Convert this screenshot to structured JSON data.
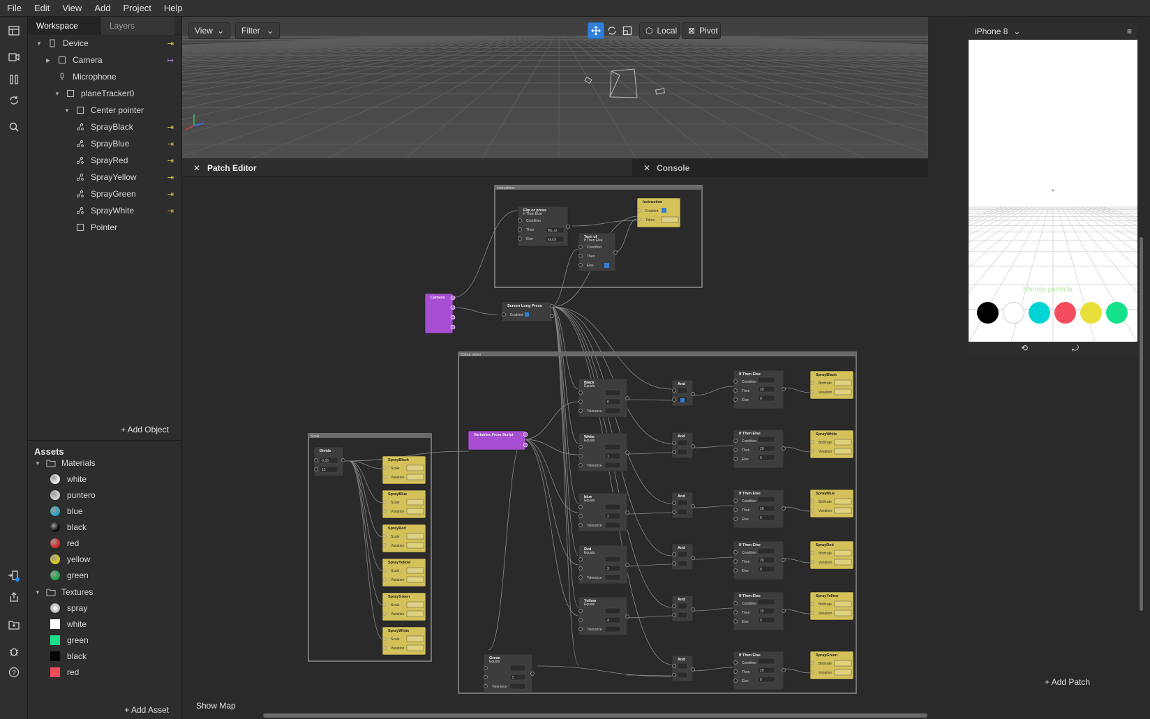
{
  "menu": [
    "File",
    "Edit",
    "View",
    "Add",
    "Project",
    "Help"
  ],
  "scene": {
    "tabs": [
      "Workspace",
      "Layers"
    ],
    "items": [
      {
        "label": "Device",
        "indent": 0,
        "arrow": "open",
        "icon": "device-icon"
      },
      {
        "label": "Camera",
        "indent": 1,
        "arrow": "closed",
        "icon": "camera-icon"
      },
      {
        "label": "Microphone",
        "indent": 1,
        "arrow": "none",
        "icon": "microphone-icon"
      },
      {
        "label": "planeTracker0",
        "indent": 1,
        "arrow": "open",
        "icon": "plane-tracker-icon"
      },
      {
        "label": "Center pointer",
        "indent": 2,
        "arrow": "open",
        "icon": "null-object-icon"
      },
      {
        "label": "SprayBlack",
        "indent": 3,
        "arrow": "none",
        "icon": "emitter-icon"
      },
      {
        "label": "SprayBlue",
        "indent": 3,
        "arrow": "none",
        "icon": "emitter-icon"
      },
      {
        "label": "SprayRed",
        "indent": 3,
        "arrow": "none",
        "icon": "emitter-icon"
      },
      {
        "label": "SprayYellow",
        "indent": 3,
        "arrow": "none",
        "icon": "emitter-icon"
      },
      {
        "label": "SprayGreen",
        "indent": 3,
        "arrow": "none",
        "icon": "emitter-icon"
      },
      {
        "label": "SprayWhite",
        "indent": 3,
        "arrow": "none",
        "icon": "emitter-icon"
      },
      {
        "label": "Pointer",
        "indent": 3,
        "arrow": "none",
        "icon": "plane-icon"
      }
    ],
    "add_object": "Add Object"
  },
  "assets": {
    "title": "Assets",
    "materials_label": "Materials",
    "materials": [
      {
        "label": "white",
        "color": "#e8e8e8"
      },
      {
        "label": "puntero",
        "color": "#cfcfcf"
      },
      {
        "label": "blue",
        "color": "#2aa6c0"
      },
      {
        "label": "black",
        "color": "#0a0a0a"
      },
      {
        "label": "red",
        "color": "#d42a2a"
      },
      {
        "label": "yellow",
        "color": "#d8c81e"
      },
      {
        "label": "green",
        "color": "#1fa84a"
      }
    ],
    "textures_label": "Textures",
    "textures": [
      {
        "label": "spray",
        "color": "#bdbdbd",
        "ball": true
      },
      {
        "label": "white",
        "color": "#ffffff",
        "ball": false
      },
      {
        "label": "green",
        "color": "#18e08a",
        "ball": false
      },
      {
        "label": "black",
        "color": "#050505",
        "ball": false
      },
      {
        "label": "red",
        "color": "#ee4b5b",
        "ball": false
      }
    ],
    "add_asset": "Add Asset"
  },
  "viewport": {
    "view_label": "View",
    "filter_label": "Filter",
    "local_label": "Local",
    "pivot_label": "Pivot"
  },
  "editor": {
    "patch_tab": "Patch Editor",
    "console_tab": "Console",
    "show_map": "Show Map",
    "add_patch": "Add Patch"
  },
  "preview": {
    "device": "iPhone 8",
    "watermark": "Maneja pantalla",
    "color_dots": [
      "#000000",
      "#ffffff",
      "#00d4d4",
      "#f24c5e",
      "#e8e038",
      "#15e08c"
    ]
  },
  "graph": {
    "groups": [
      {
        "label": "Instructions"
      },
      {
        "label": "Colour picker"
      },
      {
        "label": "Scale"
      }
    ],
    "camera": "Camera",
    "long_press": {
      "title": "Screen Long Press",
      "field": "Enabled"
    },
    "flip": {
      "title": "Flip or press",
      "sub": "If Then Else",
      "rows": [
        "Condition",
        "Then",
        "Else"
      ],
      "vals": [
        "",
        "flip_ui",
        "touch"
      ]
    },
    "turnoff": {
      "title": "Turn of",
      "sub": "If Then Else",
      "rows": [
        "Condition",
        "Then",
        "Else"
      ]
    },
    "instruction": {
      "title": "Instruction",
      "rows": [
        "Enabled",
        "Token"
      ],
      "token_val": "touch"
    },
    "vars": "Variables From Script",
    "divide": {
      "title": "Divide",
      "vals": [
        "0.33",
        "15"
      ]
    },
    "scale_nodes": [
      {
        "title": "SprayBlack",
        "scale": "0.022",
        "var": "0"
      },
      {
        "title": "SprayBlue",
        "scale": "0.022",
        "var": "0"
      },
      {
        "title": "SprayRed",
        "scale": "0.022",
        "var": "0"
      },
      {
        "title": "SprayYellow",
        "scale": "0.022",
        "var": "0"
      },
      {
        "title": "SprayGreen",
        "scale": "0.022",
        "var": "0"
      },
      {
        "title": "SprayWhite",
        "scale": "0.022",
        "var": "0"
      }
    ],
    "equals": [
      {
        "title": "Black",
        "sub": "Equals",
        "val": "0"
      },
      {
        "title": "White",
        "sub": "Equals",
        "val": "1"
      },
      {
        "title": "blue",
        "sub": "Equals",
        "val": "2"
      },
      {
        "title": "Red",
        "sub": "Equals",
        "val": "3"
      },
      {
        "title": "Yellow",
        "sub": "Equals",
        "val": "4"
      },
      {
        "title": "Green",
        "sub": "Equals",
        "val": "5"
      }
    ],
    "and_label": "And",
    "ifthen": {
      "title": "If Then Else",
      "rows": [
        "Condition",
        "Then",
        "Else"
      ],
      "then_val": "20",
      "else_val": "0"
    },
    "tolerance": "Tolerance",
    "emitters": [
      {
        "title": "SprayBlack",
        "rows": [
          "Birthrate",
          "Variation"
        ],
        "var": "0"
      },
      {
        "title": "SprayWhite",
        "rows": [
          "Birthrate",
          "Variation"
        ],
        "var": "0"
      },
      {
        "title": "SprayBlue",
        "rows": [
          "Birthrate",
          "Variation"
        ],
        "var": "0"
      },
      {
        "title": "SprayRed",
        "rows": [
          "Birthrate",
          "Variation"
        ],
        "var": "0"
      },
      {
        "title": "SprayYellow",
        "rows": [
          "Birthrate",
          "Variation"
        ],
        "var": "0"
      },
      {
        "title": "SprayGreen",
        "rows": [
          "Birthrate",
          "Variation"
        ],
        "var": "0"
      }
    ]
  }
}
